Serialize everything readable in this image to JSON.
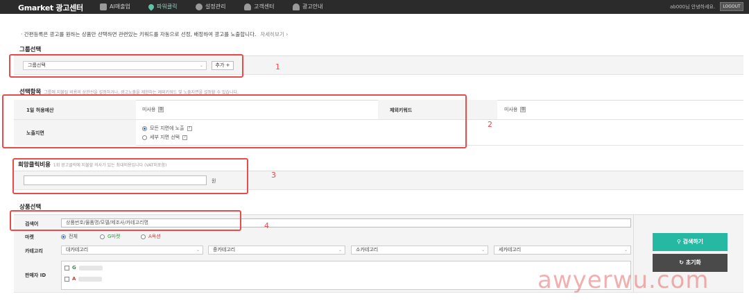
{
  "header": {
    "logo_brand": "Gmarket",
    "logo_suffix": " 광고센터",
    "nav": [
      {
        "label": "AI매출업",
        "icon": "monitor-icon"
      },
      {
        "label": "파워클릭",
        "icon": "location-pin-icon",
        "active": true
      },
      {
        "label": "설정관리",
        "icon": "gear-icon"
      },
      {
        "label": "고객센터",
        "icon": "person-icon"
      },
      {
        "label": "광고안내",
        "icon": "bell-icon"
      }
    ],
    "user_text": "ab000님 안녕하세요.",
    "logout_label": "LOGOUT"
  },
  "notice": {
    "text": "· 간편등록은 광고를 원하는 상품만 선택하면 관련있는 키워드를 자동으로 선정, 배정하여 광고를 노출합니다.",
    "more_label": "자세히보기 ›"
  },
  "group": {
    "title": "그룹선택",
    "select_value": "그룹선택",
    "add_label": "추가 +"
  },
  "options": {
    "title": "선택항목",
    "subtitle": "그룹에 지불될 비용의 상한선을 설정하거나, 광고노출을 제한하는 제외키워드 및 노출지면을 설정할 수 있습니다.",
    "daily_budget_label": "1일 허용예산",
    "daily_budget_value": "미사용",
    "exclude_keyword_label": "제외키워드",
    "exclude_keyword_value": "미사용",
    "placement_label": "노출지면",
    "placement_all": "모든 지면에 노출",
    "placement_detail": "세부 지면 선택"
  },
  "bid": {
    "title": "희망클릭비용",
    "subtitle": "1회 광고클릭에 지불할 의사가 있는 최대비용입니다 (VAT미포함)",
    "unit": "원"
  },
  "product": {
    "title": "상품선택",
    "search_label": "검색어",
    "search_placeholder": "상품번호/물품명/모델/제조사/카테고리명",
    "market_label": "마켓",
    "market_all": "전체",
    "market_g": "G마켓",
    "market_a": "A옥션",
    "category_label": "카테고리",
    "category_1": "대카테고리",
    "category_2": "중카테고리",
    "category_3": "소카테고리",
    "category_4": "세카테고리",
    "seller_label": "판매자 ID",
    "seller_g_prefix": "G",
    "seller_a_prefix": "A",
    "search_button": "검색하기",
    "reset_button": "초기화"
  },
  "annotations": [
    "1",
    "2",
    "3",
    "4"
  ],
  "watermark": "awyerwu.com",
  "colors": {
    "accent": "#25b9a4",
    "annotation": "#e94a4a",
    "topbar": "#2b2b2b"
  }
}
